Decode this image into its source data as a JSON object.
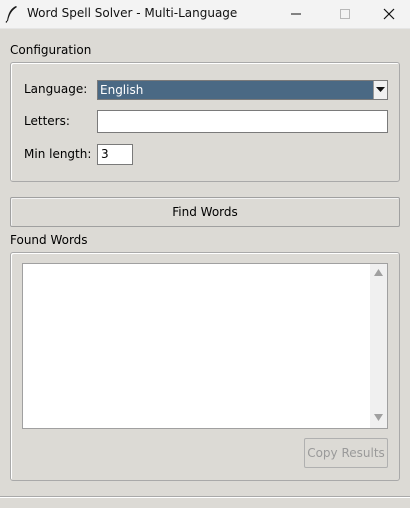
{
  "window": {
    "title": "Word Spell Solver - Multi-Language",
    "icon": "feather-icon",
    "controls": [
      "minimize-icon",
      "maximize-icon",
      "close-icon"
    ]
  },
  "configuration": {
    "section_label": "Configuration",
    "language_label": "Language:",
    "language_value": "English",
    "letters_label": "Letters:",
    "letters_value": "",
    "min_length_label": "Min length:",
    "min_length_value": "3"
  },
  "actions": {
    "find_label": "Find Words"
  },
  "results": {
    "section_label": "Found Words",
    "content": "",
    "copy_label": "Copy Results",
    "copy_enabled": false
  },
  "colors": {
    "background": "#dcdad5",
    "selection": "#4a6984",
    "disabled_text": "#9a9a9a"
  }
}
